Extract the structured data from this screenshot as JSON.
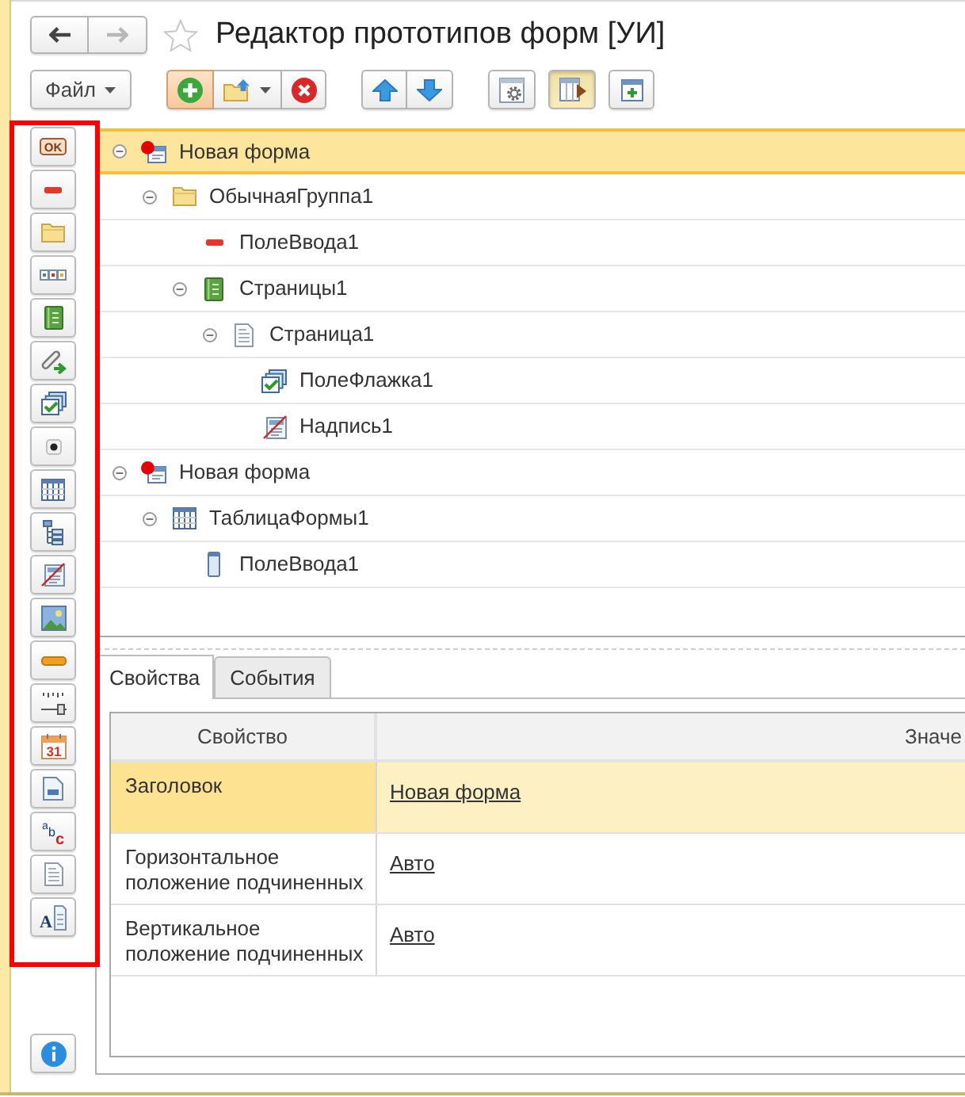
{
  "nav_buttons": [
    {
      "kind": "back",
      "disabled": false
    },
    {
      "kind": "forward",
      "disabled": true
    }
  ],
  "favorite": false,
  "title": "Редактор прототипов форм [УИ]",
  "toolbar_groups": [
    {
      "joined": true,
      "buttons": [
        {
          "kind": "menu",
          "label": "Файл",
          "dropdown": true,
          "default": false,
          "pressed": false
        }
      ]
    },
    {
      "joined": true,
      "buttons": [
        {
          "kind": "add",
          "dropdown": false,
          "default": true,
          "pressed": false
        },
        {
          "kind": "move_to_folder",
          "dropdown": true,
          "default": false,
          "pressed": false
        },
        {
          "kind": "delete",
          "dropdown": false,
          "default": false,
          "pressed": false
        }
      ]
    },
    {
      "joined": true,
      "buttons": [
        {
          "kind": "move_up",
          "dropdown": false,
          "default": false,
          "pressed": false
        },
        {
          "kind": "move_down",
          "dropdown": false,
          "default": false,
          "pressed": false
        }
      ]
    },
    {
      "joined": false,
      "buttons": [
        {
          "kind": "settings",
          "dropdown": false,
          "default": false,
          "pressed": false
        },
        {
          "kind": "preview",
          "dropdown": false,
          "default": false,
          "pressed": true
        },
        {
          "kind": "add_form",
          "dropdown": false,
          "default": false,
          "pressed": false
        }
      ]
    }
  ],
  "palette_highlighted": true,
  "palette": [
    {
      "kind": "button",
      "glyph": "OK"
    },
    {
      "kind": "input"
    },
    {
      "kind": "group"
    },
    {
      "kind": "button_group"
    },
    {
      "kind": "pages"
    },
    {
      "kind": "link"
    },
    {
      "kind": "checkbox"
    },
    {
      "kind": "radio"
    },
    {
      "kind": "table"
    },
    {
      "kind": "tree"
    },
    {
      "kind": "label"
    },
    {
      "kind": "picture"
    },
    {
      "kind": "progress"
    },
    {
      "kind": "slider"
    },
    {
      "kind": "calendar",
      "glyph": "31"
    },
    {
      "kind": "document_field"
    },
    {
      "kind": "spelling",
      "glyph": "abc"
    },
    {
      "kind": "document"
    },
    {
      "kind": "formatted_document",
      "glyph": "A"
    }
  ],
  "info_button": {
    "kind": "info"
  },
  "tree": [
    {
      "label": "Новая форма",
      "kind": "form",
      "selected": true,
      "expanded": true,
      "children": [
        {
          "label": "ОбычнаяГруппа1",
          "kind": "group",
          "selected": false,
          "expanded": true,
          "children": [
            {
              "label": "ПолеВвода1",
              "kind": "input",
              "selected": false
            },
            {
              "label": "Страницы1",
              "kind": "pages",
              "selected": false,
              "expanded": true,
              "children": [
                {
                  "label": "Страница1",
                  "kind": "page",
                  "selected": false,
                  "expanded": true,
                  "children": [
                    {
                      "label": "ПолеФлажка1",
                      "kind": "checkbox",
                      "selected": false
                    },
                    {
                      "label": "Надпись1",
                      "kind": "label",
                      "selected": false
                    }
                  ]
                }
              ]
            }
          ]
        }
      ]
    },
    {
      "label": "Новая форма",
      "kind": "form",
      "selected": false,
      "expanded": true,
      "children": [
        {
          "label": "ТаблицаФормы1",
          "kind": "table",
          "selected": false,
          "expanded": true,
          "children": [
            {
              "label": "ПолеВвода1",
              "kind": "column",
              "selected": false
            }
          ]
        }
      ]
    }
  ],
  "tabs": [
    {
      "label": "Свойства",
      "selected": true
    },
    {
      "label": "События",
      "selected": false
    }
  ],
  "properties_table": {
    "columns": [
      "Свойство",
      "Значе"
    ],
    "rows": [
      {
        "property": "Заголовок",
        "value": "Новая форма",
        "selected": true
      },
      {
        "property": "Горизонтальное положение подчиненных",
        "value": "Авто",
        "selected": false
      },
      {
        "property": "Вертикальное положение подчиненных",
        "value": "Авто",
        "selected": false
      }
    ]
  }
}
